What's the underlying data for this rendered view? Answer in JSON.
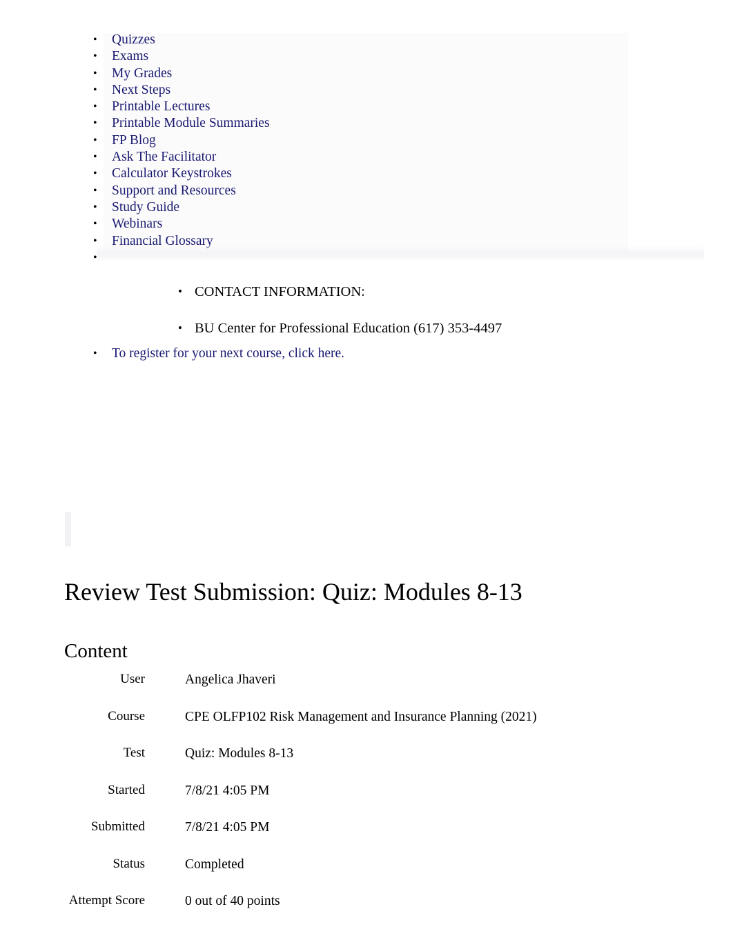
{
  "nav": {
    "items": [
      {
        "label": "Quizzes"
      },
      {
        "label": "Exams"
      },
      {
        "label": "My Grades"
      },
      {
        "label": "Next Steps"
      },
      {
        "label": "Printable Lectures"
      },
      {
        "label": "Printable Module Summaries"
      },
      {
        "label": "FP Blog"
      },
      {
        "label": "Ask The Facilitator"
      },
      {
        "label": "Calculator Keystrokes"
      },
      {
        "label": "Support and Resources"
      },
      {
        "label": "Study Guide"
      },
      {
        "label": "Webinars"
      },
      {
        "label": "Financial Glossary"
      },
      {
        "label": ""
      }
    ],
    "link_color": "#191970"
  },
  "contact": {
    "heading": "CONTACT INFORMATION:",
    "detail": "BU Center for Professional Education (617) 353-4497",
    "register_link": "To register for your next course, click here."
  },
  "main": {
    "title": "Review Test Submission: Quiz: Modules 8-13",
    "section_heading": "Content"
  },
  "details": {
    "rows": [
      {
        "label": "User",
        "value": "Angelica Jhaveri"
      },
      {
        "label": "Course",
        "value": "CPE OLFP102 Risk Management and Insurance Planning (2021)"
      },
      {
        "label": "Test",
        "value": "Quiz: Modules 8-13"
      },
      {
        "label": "Started",
        "value": "7/8/21 4:05 PM"
      },
      {
        "label": "Submitted",
        "value": "7/8/21 4:05 PM"
      },
      {
        "label": "Status",
        "value": "Completed"
      },
      {
        "label": "Attempt Score",
        "value": "0 out of 40 points"
      }
    ]
  }
}
